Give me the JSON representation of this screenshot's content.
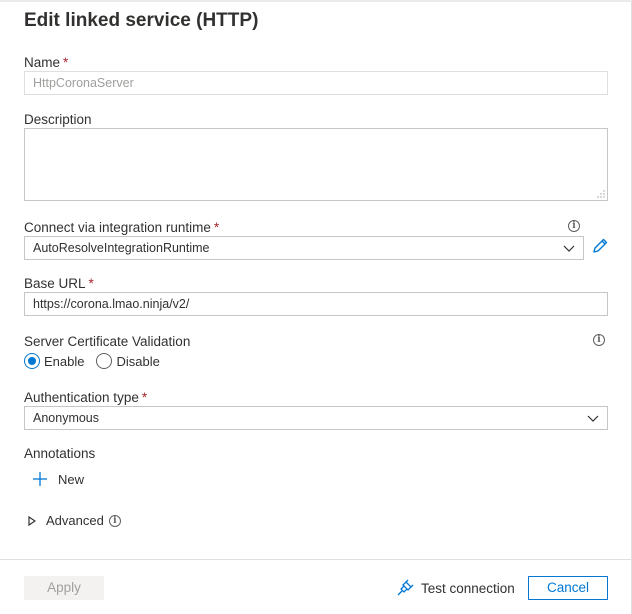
{
  "title": "Edit linked service (HTTP)",
  "name": {
    "label": "Name",
    "required": "*",
    "placeholder": "HttpCoronaServer"
  },
  "description": {
    "label": "Description",
    "value": ""
  },
  "runtime": {
    "label": "Connect via integration runtime",
    "required": "*",
    "value": "AutoResolveIntegrationRuntime",
    "info_icon": "info-icon",
    "edit_icon": "pencil-icon"
  },
  "base_url": {
    "label": "Base URL",
    "required": "*",
    "value": "https://corona.lmao.ninja/v2/"
  },
  "cert": {
    "label": "Server Certificate Validation",
    "options": [
      "Enable",
      "Disable"
    ],
    "selected": "Enable"
  },
  "auth": {
    "label": "Authentication type",
    "required": "*",
    "value": "Anonymous"
  },
  "annotations": {
    "label": "Annotations",
    "new_label": "New"
  },
  "advanced": {
    "label": "Advanced"
  },
  "footer": {
    "apply": "Apply",
    "test_connection": "Test connection",
    "cancel": "Cancel"
  },
  "colors": {
    "accent": "#0078d4",
    "required": "#a4262c",
    "border": "#c8c6c4",
    "disabled_text": "#a19f9d"
  }
}
